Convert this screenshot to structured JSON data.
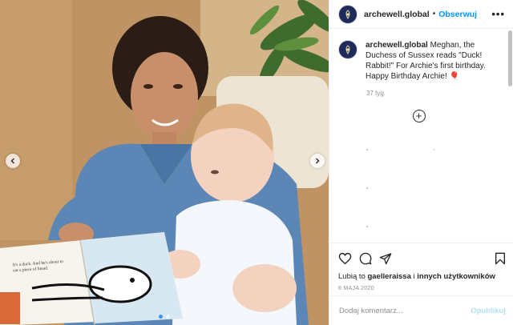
{
  "post": {
    "username": "archewell.global",
    "follow_label": "Obserwuj",
    "more_label": "•••",
    "caption_user": "archewell.global",
    "caption_text": "Meghan, the Duchess of Sussex reads \"Duck! Rabbit!\" For Archie's first birthday. Happy Birthday Archie! 🎈",
    "time_ago": "37 tyg.",
    "load_more_label": "+",
    "likes_prefix": "Lubią to ",
    "likes_user": "gaelleraissa",
    "likes_mid": " i ",
    "likes_others": "innych użytkowników",
    "date": "6 MAJA 2020",
    "comment_placeholder": "Dodaj komentarz...",
    "post_label": "Opublikuj"
  },
  "media": {
    "book_text": "It's a duck. And he's about to eat a piece of bread.",
    "carousel_dots": 2,
    "active_dot": 1
  },
  "icons": {
    "heart": "heart-icon",
    "comment": "comment-icon",
    "share": "share-icon",
    "bookmark": "bookmark-icon",
    "prev": "chevron-left-icon",
    "next": "chevron-right-icon"
  },
  "colors": {
    "accent": "#0095f6",
    "muted": "#8e8e8e",
    "post_disabled": "#b2dffc"
  }
}
